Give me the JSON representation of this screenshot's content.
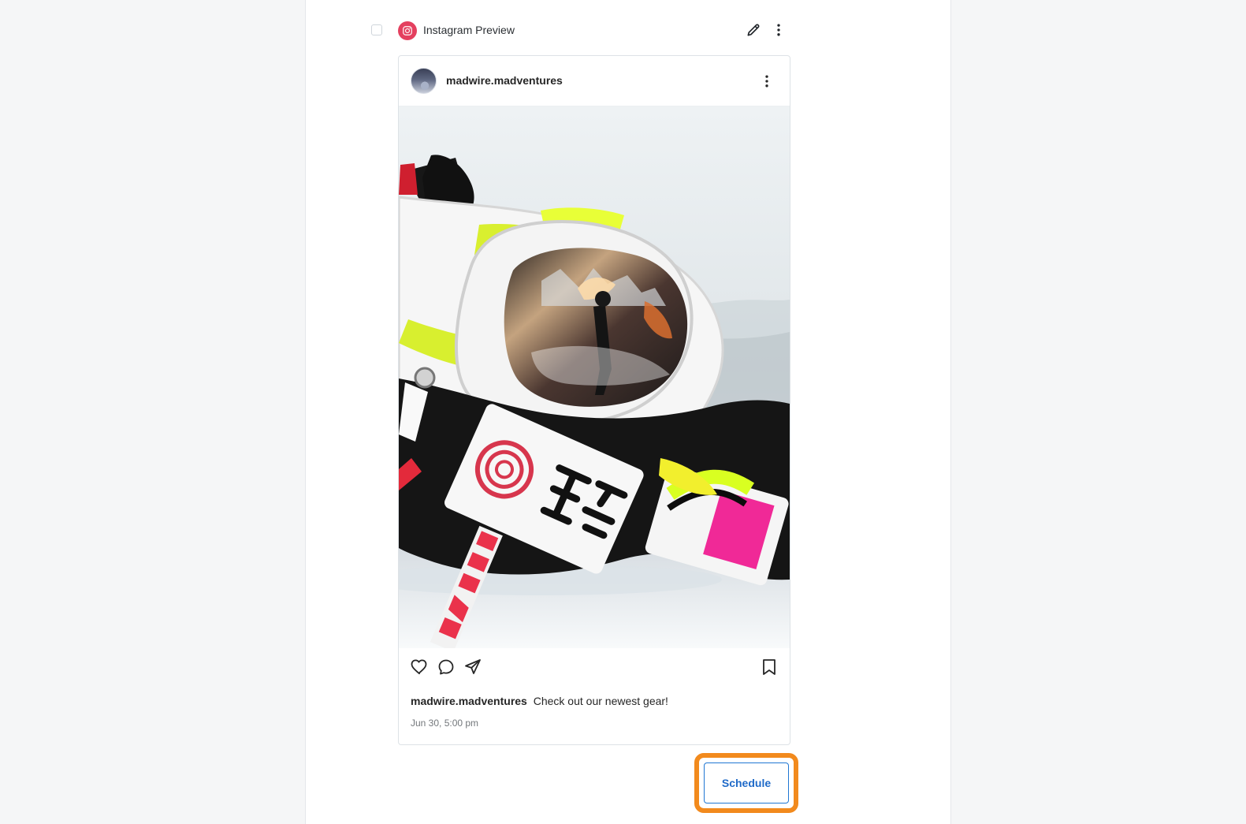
{
  "preview": {
    "title": "Instagram Preview"
  },
  "post": {
    "username": "madwire.madventures",
    "caption_user": "madwire.madventures",
    "caption_text": "Check out our newest gear!",
    "timestamp": "Jun 30, 5:00 pm"
  },
  "actions": {
    "schedule_label": "Schedule"
  },
  "icons": {
    "instagram": "instagram-icon",
    "edit": "pencil-icon",
    "more": "more-vertical-icon",
    "like": "heart-icon",
    "comment": "comment-icon",
    "share": "send-icon",
    "save": "bookmark-icon"
  },
  "colors": {
    "instagram_badge": "#e4405f",
    "schedule_highlight": "#f28a1d",
    "schedule_text": "#1f6ac8"
  }
}
